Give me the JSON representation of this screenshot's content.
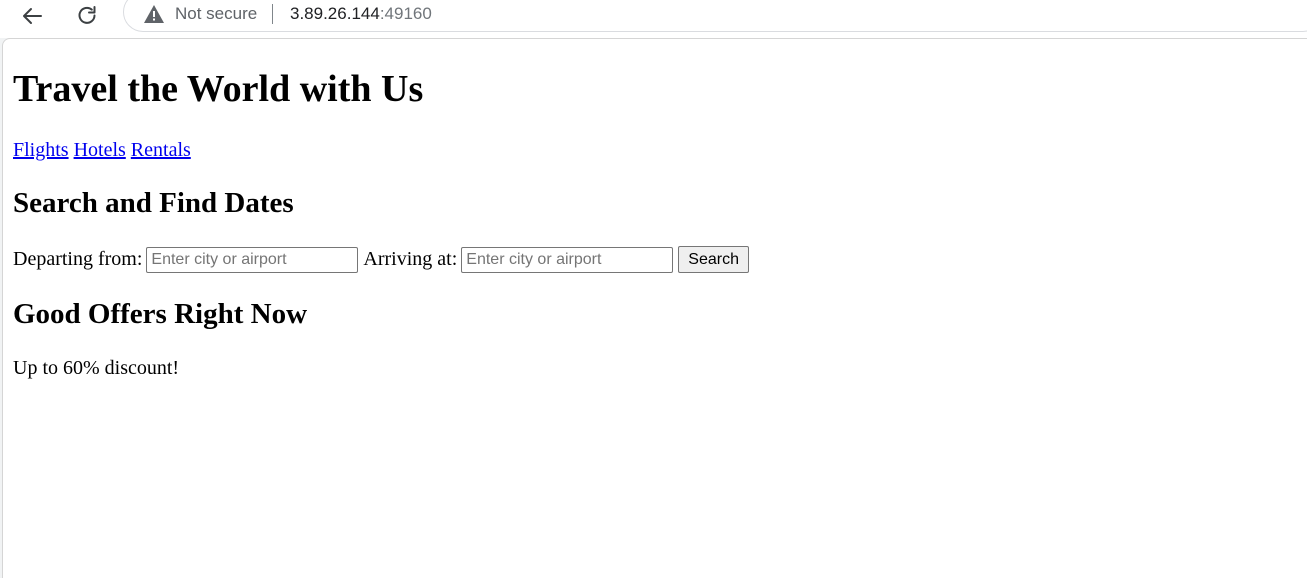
{
  "browser": {
    "security_label": "Not secure",
    "url_host": "3.89.26.144",
    "url_port": ":49160"
  },
  "page": {
    "title": "Travel the World with Us",
    "nav_links": [
      "Flights",
      "Hotels",
      "Rentals"
    ],
    "search_heading": "Search and Find Dates",
    "departing_label": "Departing from:",
    "departing_placeholder": "Enter city or airport",
    "arriving_label": "Arriving at:",
    "arriving_placeholder": "Enter city or airport",
    "search_button": "Search",
    "offers_heading": "Good Offers Right Now",
    "offer_text": "Up to 60% discount!"
  },
  "icons": {
    "back": "arrow-left-icon",
    "reload": "reload-icon",
    "security": "warning-triangle-icon"
  }
}
